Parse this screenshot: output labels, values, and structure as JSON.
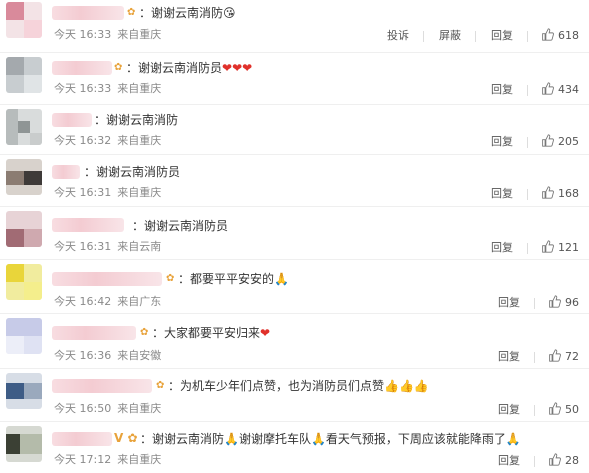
{
  "comments": [
    {
      "text": "谢谢云南消防",
      "emoji": "😘",
      "time": "今天 16:33",
      "location": "来自重庆",
      "report": "投诉",
      "block": "屏蔽",
      "reply": "回复",
      "likes": "618"
    },
    {
      "text": "谢谢云南消防员",
      "emoji": "❤❤❤",
      "time": "今天 16:33",
      "location": "来自重庆",
      "reply": "回复",
      "likes": "434"
    },
    {
      "text": "谢谢云南消防",
      "emoji": "",
      "time": "今天 16:32",
      "location": "来自重庆",
      "reply": "回复",
      "likes": "205"
    },
    {
      "text": "谢谢云南消防员",
      "emoji": "",
      "time": "今天 16:31",
      "location": "来自重庆",
      "reply": "回复",
      "likes": "168"
    },
    {
      "text": "谢谢云南消防员",
      "emoji": "",
      "time": "今天 16:31",
      "location": "来自云南",
      "reply": "回复",
      "likes": "121"
    },
    {
      "text": "都要平平安安的",
      "emoji": "🙏",
      "time": "今天 16:42",
      "location": "来自广东",
      "reply": "回复",
      "likes": "96"
    },
    {
      "text": "大家都要平安归来",
      "emoji": "❤",
      "time": "今天 16:36",
      "location": "来自安徽",
      "reply": "回复",
      "likes": "72"
    },
    {
      "text": "为机车少年们点赞，也为消防员们点赞",
      "emoji": "👍👍👍",
      "time": "今天 16:50",
      "location": "来自重庆",
      "reply": "回复",
      "likes": "50"
    },
    {
      "text": "谢谢云南消防🙏谢谢摩托车队🙏看天气预报，下周应该就能降雨了",
      "emoji": "🙏",
      "time": "今天 17:12",
      "location": "来自重庆",
      "reply": "回复",
      "likes": "28"
    }
  ]
}
